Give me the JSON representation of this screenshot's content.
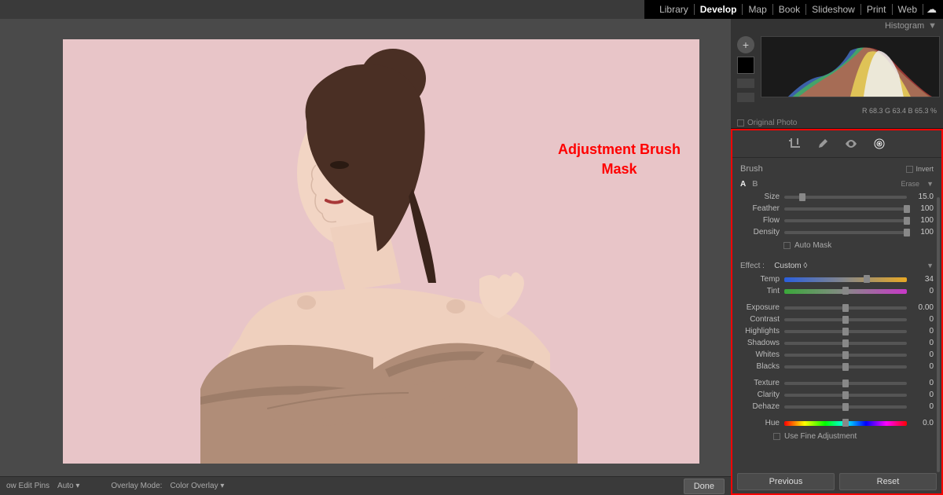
{
  "modules": [
    "Library",
    "Develop",
    "Map",
    "Book",
    "Slideshow",
    "Print",
    "Web"
  ],
  "active_module": "Develop",
  "histogram": {
    "title": "Histogram",
    "readout": "R  68.3   G   63.4   B   65.3   %",
    "original_photo": "Original Photo"
  },
  "annotation": "Adjustment Brush\nMask",
  "brush": {
    "section_label": "Brush",
    "invert_label": "Invert",
    "a": "A",
    "b": "B",
    "erase": "Erase",
    "sliders": {
      "size": {
        "label": "Size",
        "value": "15.0",
        "pos": 15
      },
      "feather": {
        "label": "Feather",
        "value": "100",
        "pos": 100
      },
      "flow": {
        "label": "Flow",
        "value": "100",
        "pos": 100
      },
      "density": {
        "label": "Density",
        "value": "100",
        "pos": 100
      }
    },
    "automask_label": "Auto Mask"
  },
  "effect": {
    "label": "Effect :",
    "preset": "Custom  ◊",
    "sliders": {
      "temp": {
        "label": "Temp",
        "value": "34",
        "pos": 67
      },
      "tint": {
        "label": "Tint",
        "value": "0",
        "pos": 50
      },
      "exposure": {
        "label": "Exposure",
        "value": "0.00",
        "pos": 50
      },
      "contrast": {
        "label": "Contrast",
        "value": "0",
        "pos": 50
      },
      "highlights": {
        "label": "Highlights",
        "value": "0",
        "pos": 50
      },
      "shadows": {
        "label": "Shadows",
        "value": "0",
        "pos": 50
      },
      "whites": {
        "label": "Whites",
        "value": "0",
        "pos": 50
      },
      "blacks": {
        "label": "Blacks",
        "value": "0",
        "pos": 50
      },
      "texture": {
        "label": "Texture",
        "value": "0",
        "pos": 50
      },
      "clarity": {
        "label": "Clarity",
        "value": "0",
        "pos": 50
      },
      "dehaze": {
        "label": "Dehaze",
        "value": "0",
        "pos": 50
      },
      "hue": {
        "label": "Hue",
        "value": "0.0",
        "pos": 50
      }
    },
    "usefine_label": "Use Fine Adjustment"
  },
  "bottom": {
    "edit_pins": "ow Edit Pins",
    "auto": "Auto   ▾",
    "overlay_mode": "Overlay Mode:",
    "color_overlay": "Color Overlay   ▾",
    "done": "Done",
    "previous": "Previous",
    "reset": "Reset"
  }
}
